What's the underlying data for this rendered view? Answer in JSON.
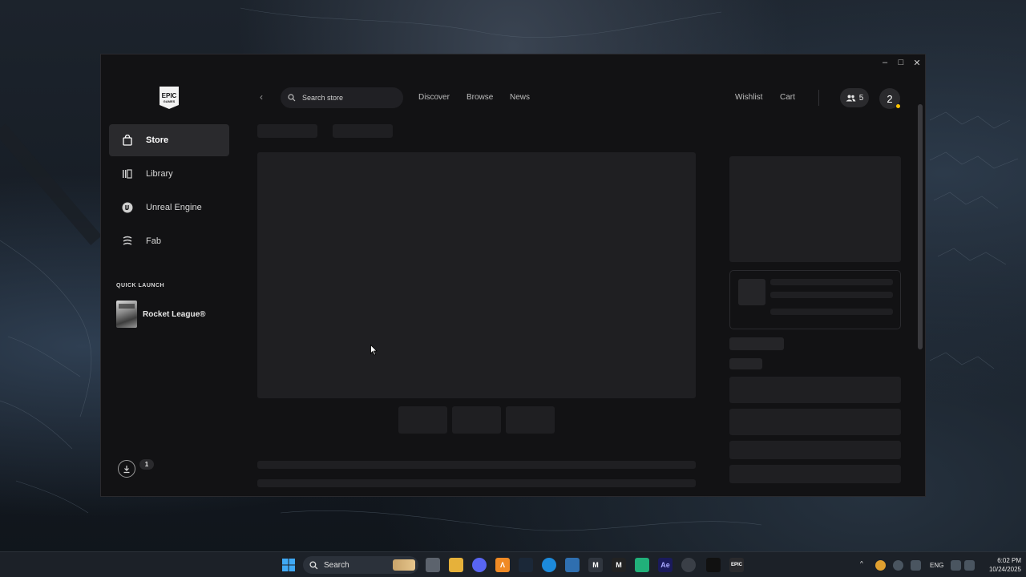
{
  "window": {
    "controls": {
      "minimize": "–",
      "maximize": "□",
      "close": "✕"
    }
  },
  "sidebar": {
    "logo": {
      "top": "EPIC",
      "bottom": "GAMES"
    },
    "items": [
      {
        "label": "Store",
        "icon": "shopping-bag-icon",
        "active": true
      },
      {
        "label": "Library",
        "icon": "library-icon",
        "active": false
      },
      {
        "label": "Unreal Engine",
        "icon": "unreal-engine-icon",
        "active": false
      },
      {
        "label": "Fab",
        "icon": "fab-icon",
        "active": false
      }
    ],
    "quick_launch": {
      "title": "QUICK LAUNCH",
      "items": [
        {
          "label": "Rocket League®"
        }
      ]
    },
    "downloads": {
      "count": "1"
    }
  },
  "topbar": {
    "back": "‹",
    "search": {
      "placeholder": "Search store",
      "value": ""
    },
    "links": [
      "Discover",
      "Browse",
      "News"
    ],
    "right_links": [
      "Wishlist",
      "Cart"
    ],
    "friends_count": "5",
    "avatar_initial": "2",
    "status_color": "#ffc400"
  },
  "taskbar": {
    "search_label": "Search",
    "tray": {
      "language": "ENG"
    },
    "clock": {
      "time": "6:02 PM",
      "date": "10/24/2025"
    }
  },
  "colors": {
    "window_bg": "#121214",
    "skeleton": "#1f1f22",
    "active_nav": "#2a2a2d"
  }
}
